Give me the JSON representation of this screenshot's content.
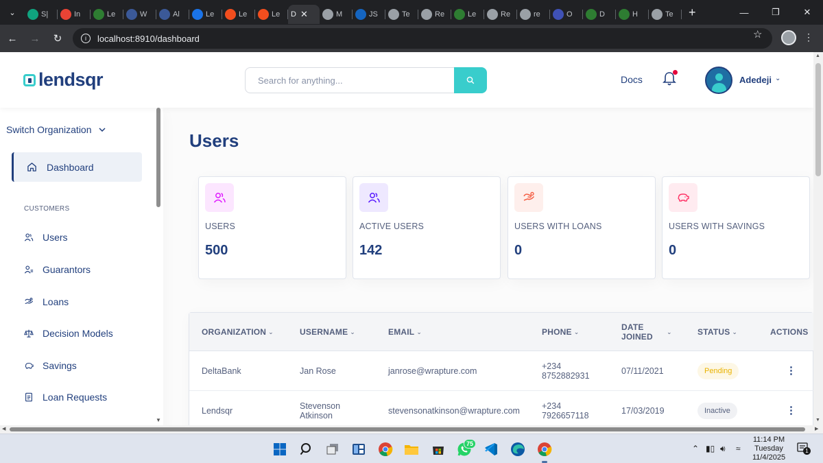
{
  "browser": {
    "tabs": [
      {
        "label": "S|",
        "icon": "openai-icon",
        "color": "#10a37f"
      },
      {
        "label": "In",
        "icon": "gmail-icon",
        "color": "#ea4335"
      },
      {
        "label": "Le",
        "icon": "lendsqr-icon",
        "color": "#2e7d32"
      },
      {
        "label": "W",
        "icon": "w-icon",
        "color": "#3b5998"
      },
      {
        "label": "Al",
        "icon": "lens-icon",
        "color": "#3b5998"
      },
      {
        "label": "Le",
        "icon": "lens-icon",
        "color": "#1a73e8"
      },
      {
        "label": "Le",
        "icon": "figma-icon",
        "color": "#f24e1e"
      },
      {
        "label": "Le",
        "icon": "figma-icon",
        "color": "#f24e1e"
      },
      {
        "label": "D",
        "icon": "",
        "color": "#5f6368"
      },
      {
        "label": "M",
        "icon": "openai-icon",
        "color": "#9aa0a6"
      },
      {
        "label": "JS",
        "icon": "js-icon",
        "color": "#1565c0"
      },
      {
        "label": "Te",
        "icon": "openai-icon",
        "color": "#9aa0a6"
      },
      {
        "label": "Re",
        "icon": "openai-icon",
        "color": "#9aa0a6"
      },
      {
        "label": "Le",
        "icon": "lendsqr-icon",
        "color": "#2e7d32"
      },
      {
        "label": "Re",
        "icon": "openai-icon",
        "color": "#9aa0a6"
      },
      {
        "label": "re",
        "icon": "globe-icon",
        "color": "#9aa0a6"
      },
      {
        "label": "O",
        "icon": "o-icon",
        "color": "#3f51b5"
      },
      {
        "label": "D",
        "icon": "lendsqr-icon",
        "color": "#2e7d32"
      },
      {
        "label": "H",
        "icon": "lendsqr-icon",
        "color": "#2e7d32"
      },
      {
        "label": "Te",
        "icon": "openai-icon",
        "color": "#9aa0a6"
      }
    ],
    "active_tab_index": 8,
    "url": "localhost:8910/dashboard"
  },
  "header": {
    "logo_text": "lendsqr",
    "search_placeholder": "Search for anything...",
    "docs_label": "Docs",
    "user_name": "Adedeji"
  },
  "sidebar": {
    "switch_org_label": "Switch Organization",
    "dashboard_label": "Dashboard",
    "section_customers": "CUSTOMERS",
    "items": [
      {
        "label": "Users",
        "icon": "users-icon"
      },
      {
        "label": "Guarantors",
        "icon": "guarantors-icon"
      },
      {
        "label": "Loans",
        "icon": "loans-icon"
      },
      {
        "label": "Decision Models",
        "icon": "decision-models-icon"
      },
      {
        "label": "Savings",
        "icon": "savings-icon"
      },
      {
        "label": "Loan Requests",
        "icon": "loan-requests-icon"
      }
    ]
  },
  "main": {
    "title": "Users",
    "cards": [
      {
        "label": "USERS",
        "value": "500",
        "icon": "users-icon",
        "bg": "#fce6ff",
        "fg": "#df18ff"
      },
      {
        "label": "ACTIVE USERS",
        "value": "142",
        "icon": "active-users-icon",
        "bg": "#eee8ff",
        "fg": "#5718ff"
      },
      {
        "label": "USERS WITH LOANS",
        "value": "0",
        "icon": "loans-icon",
        "bg": "#feefec",
        "fg": "#f55f44"
      },
      {
        "label": "USERS WITH SAVINGS",
        "value": "0",
        "icon": "savings-icon",
        "bg": "#ffebf0",
        "fg": "#ff3366"
      }
    ],
    "table": {
      "columns": [
        "ORGANIZATION",
        "USERNAME",
        "EMAIL",
        "PHONE",
        "DATE JOINED",
        "STATUS",
        "ACTIONS"
      ],
      "rows": [
        {
          "organization": "DeltaBank",
          "username": "Jan Rose",
          "email": "janrose@wrapture.com",
          "phone": "+234 8752882931",
          "date_joined": "07/11/2021",
          "status": "Pending"
        },
        {
          "organization": "Lendsqr",
          "username": "Stevenson Atkinson",
          "email": "stevensonatkinson@wrapture.com",
          "phone": "+234 7926657118",
          "date_joined": "17/03/2019",
          "status": "Inactive"
        }
      ]
    }
  },
  "taskbar": {
    "time": "11:14 PM",
    "day": "Tuesday",
    "date": "11/4/2025",
    "whatsapp_badge": "75",
    "notification_count": "1"
  }
}
